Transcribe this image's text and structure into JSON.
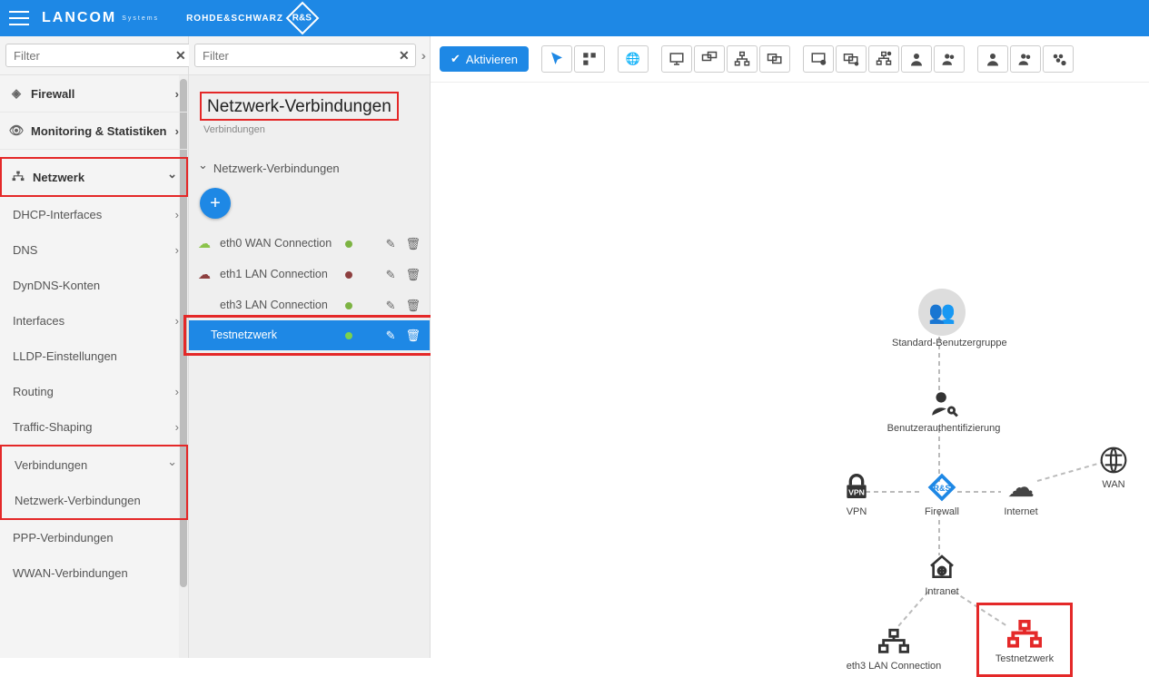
{
  "header": {
    "brand1": "LANCOM",
    "brand1_sub": "Systems",
    "brand2": "ROHDE&SCHWARZ",
    "brand2_badge": "R&S"
  },
  "filters": {
    "left_placeholder": "Filter",
    "mid_placeholder": "Filter"
  },
  "nav": {
    "items": [
      {
        "label": "Firewall",
        "icon": "shield",
        "expandable": true
      },
      {
        "label": "Monitoring & Statistiken",
        "icon": "eye",
        "expandable": true
      },
      {
        "label": "Netzwerk",
        "icon": "sitemap",
        "expandable": true,
        "open": true,
        "highlight": true,
        "children": [
          {
            "label": "DHCP-Interfaces",
            "expandable": true
          },
          {
            "label": "DNS",
            "expandable": true
          },
          {
            "label": "DynDNS-Konten"
          },
          {
            "label": "Interfaces",
            "expandable": true
          },
          {
            "label": "LLDP-Einstellungen"
          },
          {
            "label": "Routing",
            "expandable": true
          },
          {
            "label": "Traffic-Shaping",
            "expandable": true
          },
          {
            "label": "Verbindungen",
            "expandable": true,
            "open": true,
            "highlight": true,
            "children": [
              {
                "label": "Netzwerk-Verbindungen",
                "highlight": true
              },
              {
                "label": "PPP-Verbindungen"
              },
              {
                "label": "WWAN-Verbindungen"
              }
            ]
          }
        ]
      }
    ]
  },
  "midpanel": {
    "title": "Netzwerk-Verbindungen",
    "subtitle": "Verbindungen",
    "section": "Netzwerk-Verbindungen",
    "connections": [
      {
        "name": "eth0 WAN Connection",
        "status": "green",
        "cloud": "green"
      },
      {
        "name": "eth1 LAN Connection",
        "status": "red",
        "cloud": "red"
      },
      {
        "name": "eth3 LAN Connection",
        "status": "green",
        "cloud": "green"
      },
      {
        "name": "Testnetzwerk",
        "status": "green",
        "selected": true,
        "highlight": true
      }
    ]
  },
  "toolbar": {
    "activate": "Aktivieren"
  },
  "topology": {
    "nodes": {
      "userGroup": {
        "label": "Standard-Benutzergruppe"
      },
      "auth": {
        "label": "Benutzerauthentifizierung"
      },
      "vpn": {
        "label": "VPN"
      },
      "firewall": {
        "label": "Firewall"
      },
      "internet": {
        "label": "Internet"
      },
      "wan": {
        "label": "WAN"
      },
      "intranet": {
        "label": "Intranet"
      },
      "eth3": {
        "label": "eth3 LAN Connection"
      },
      "testnet": {
        "label": "Testnetzwerk",
        "highlight": true
      }
    }
  }
}
